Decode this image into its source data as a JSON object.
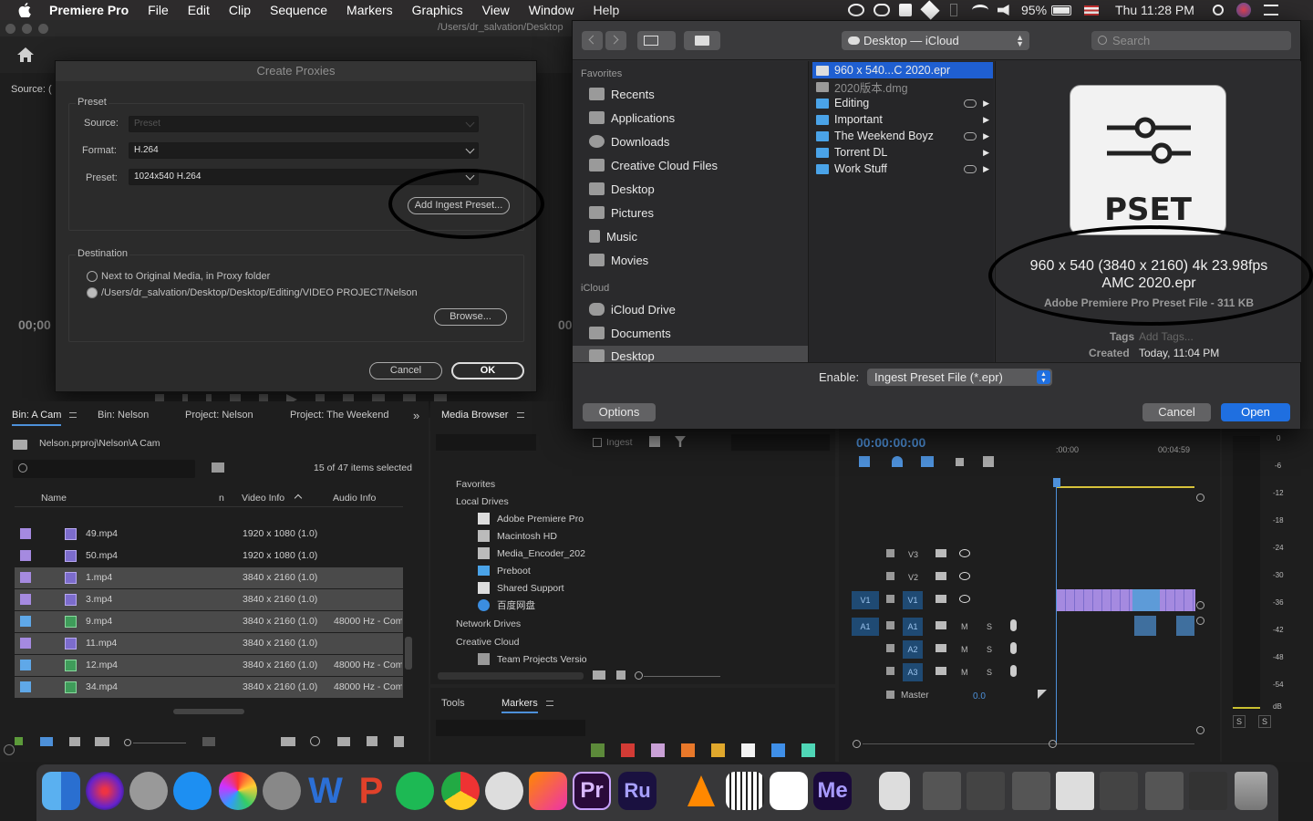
{
  "menubar": {
    "app": "Premiere Pro",
    "items": [
      "File",
      "Edit",
      "Clip",
      "Sequence",
      "Markers",
      "Graphics",
      "View",
      "Window",
      "Help"
    ],
    "battery": "95%",
    "clock": "Thu 11:28 PM"
  },
  "window": {
    "path_title": "/Users/dr_salvation/Desktop"
  },
  "source_monitor": {
    "label": "Source: (",
    "timecode": "00;00"
  },
  "program_monitor": {
    "timecode": "00"
  },
  "create_proxies": {
    "title": "Create Proxies",
    "preset_group": "Preset",
    "source_label": "Source:",
    "source_value": "Preset",
    "format_label": "Format:",
    "format_value": "H.264",
    "preset_label": "Preset:",
    "preset_value": "1024x540 H.264",
    "add_ingest_button": "Add Ingest Preset...",
    "destination_group": "Destination",
    "dest_option1": "Next to Original Media, in Proxy folder",
    "dest_option2": "/Users/dr_salvation/Desktop/Desktop/Editing/VIDEO PROJECT/Nelson",
    "browse_button": "Browse...",
    "cancel_button": "Cancel",
    "ok_button": "OK"
  },
  "finder": {
    "location": "Desktop — iCloud",
    "search_placeholder": "Search",
    "favorites_header": "Favorites",
    "favorites": [
      "Recents",
      "Applications",
      "Downloads",
      "Creative Cloud Files",
      "Desktop",
      "Pictures",
      "Music",
      "Movies"
    ],
    "icloud_header": "iCloud",
    "icloud_items": [
      "iCloud Drive",
      "Documents",
      "Desktop"
    ],
    "files": [
      "960 x 540...C 2020.epr",
      "2020版本.dmg",
      "Editing",
      "Important",
      "The Weekend Boyz",
      "Torrent DL",
      "Work Stuff"
    ],
    "preview_icon_text": "PSET",
    "preview_name_line1": "960 x 540 (3840 x 2160) 4k 23.98fps",
    "preview_name_line2": "AMC 2020.epr",
    "preview_kind": "Adobe Premiere Pro Preset File - 311 KB",
    "tags_label": "Tags",
    "tags_placeholder": "Add Tags...",
    "created_label": "Created",
    "created_value": "Today, 11:04 PM",
    "enable_label": "Enable:",
    "enable_value": "Ingest Preset File (*.epr)",
    "options_button": "Options",
    "cancel_button": "Cancel",
    "open_button": "Open"
  },
  "bin_panel": {
    "tabs": [
      "Bin: A Cam",
      "Bin: Nelson",
      "Project: Nelson",
      "Project: The Weekend"
    ],
    "path": "Nelson.prproj\\Nelson\\A Cam",
    "selected_count": "15 of 47 items selected",
    "col_name": "Name",
    "col_n": "n",
    "col_video": "Video Info",
    "col_audio": "Audio Info",
    "rows": [
      {
        "name": "49.mp4",
        "video": "1920 x 1080 (1.0)",
        "audio": ""
      },
      {
        "name": "50.mp4",
        "video": "1920 x 1080 (1.0)",
        "audio": ""
      },
      {
        "name": "1.mp4",
        "video": "3840 x 2160 (1.0)",
        "audio": ""
      },
      {
        "name": "3.mp4",
        "video": "3840 x 2160 (1.0)",
        "audio": ""
      },
      {
        "name": "9.mp4",
        "video": "3840 x 2160 (1.0)",
        "audio": "48000 Hz - Com"
      },
      {
        "name": "11.mp4",
        "video": "3840 x 2160 (1.0)",
        "audio": ""
      },
      {
        "name": "12.mp4",
        "video": "3840 x 2160 (1.0)",
        "audio": "48000 Hz - Com"
      },
      {
        "name": "34.mp4",
        "video": "3840 x 2160 (1.0)",
        "audio": "48000 Hz - Com"
      }
    ]
  },
  "media_browser": {
    "title": "Media Browser",
    "ingest_label": "Ingest",
    "favorites": "Favorites",
    "local_drives": "Local Drives",
    "drives": [
      "Adobe Premiere Pro",
      "Macintosh HD",
      "Media_Encoder_202",
      "Preboot",
      "Shared Support",
      "百度网盘"
    ],
    "network_drives": "Network Drives",
    "creative_cloud": "Creative Cloud",
    "team_projects": "Team Projects Versio"
  },
  "tools_markers": {
    "tools_tab": "Tools",
    "markers_tab": "Markers",
    "colors": [
      "#5c8a3a",
      "#d23b35",
      "#c9a0d6",
      "#e8782a",
      "#e0a82c",
      "#f2f2f2",
      "#3f8fe8",
      "#4fd6b6"
    ]
  },
  "timeline": {
    "timecode": "00:00:00:00",
    "ruler_start": ":00:00",
    "ruler_end": "00:04:59",
    "tracks": [
      {
        "id": "V3"
      },
      {
        "id": "V2"
      },
      {
        "id": "V1",
        "src": "V1"
      },
      {
        "id": "A1",
        "src": "A1"
      },
      {
        "id": "A2"
      },
      {
        "id": "A3"
      }
    ],
    "master_label": "Master",
    "master_value": "0.0",
    "m_label": "M",
    "s_label": "S"
  },
  "audio_meter": {
    "ticks": [
      "0",
      "-6",
      "-12",
      "-18",
      "-24",
      "-30",
      "-36",
      "-42",
      "-48",
      "-54",
      "dB"
    ],
    "solo": "S"
  }
}
